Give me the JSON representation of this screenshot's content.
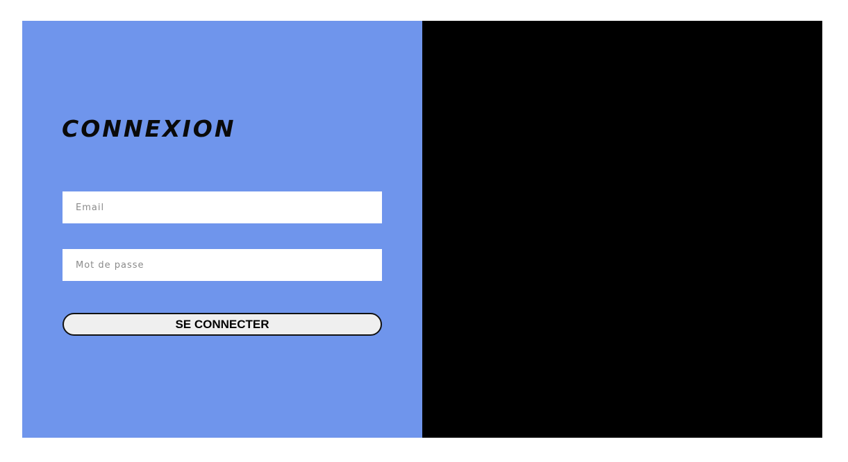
{
  "login": {
    "title": "CONNEXION",
    "email_placeholder": "Email",
    "password_placeholder": "Mot de passe",
    "submit_label": "SE CONNECTER"
  },
  "colors": {
    "left_panel": "#6f95ec",
    "right_panel": "#000000",
    "field_background": "#ffffff",
    "button_background": "#efefef"
  }
}
